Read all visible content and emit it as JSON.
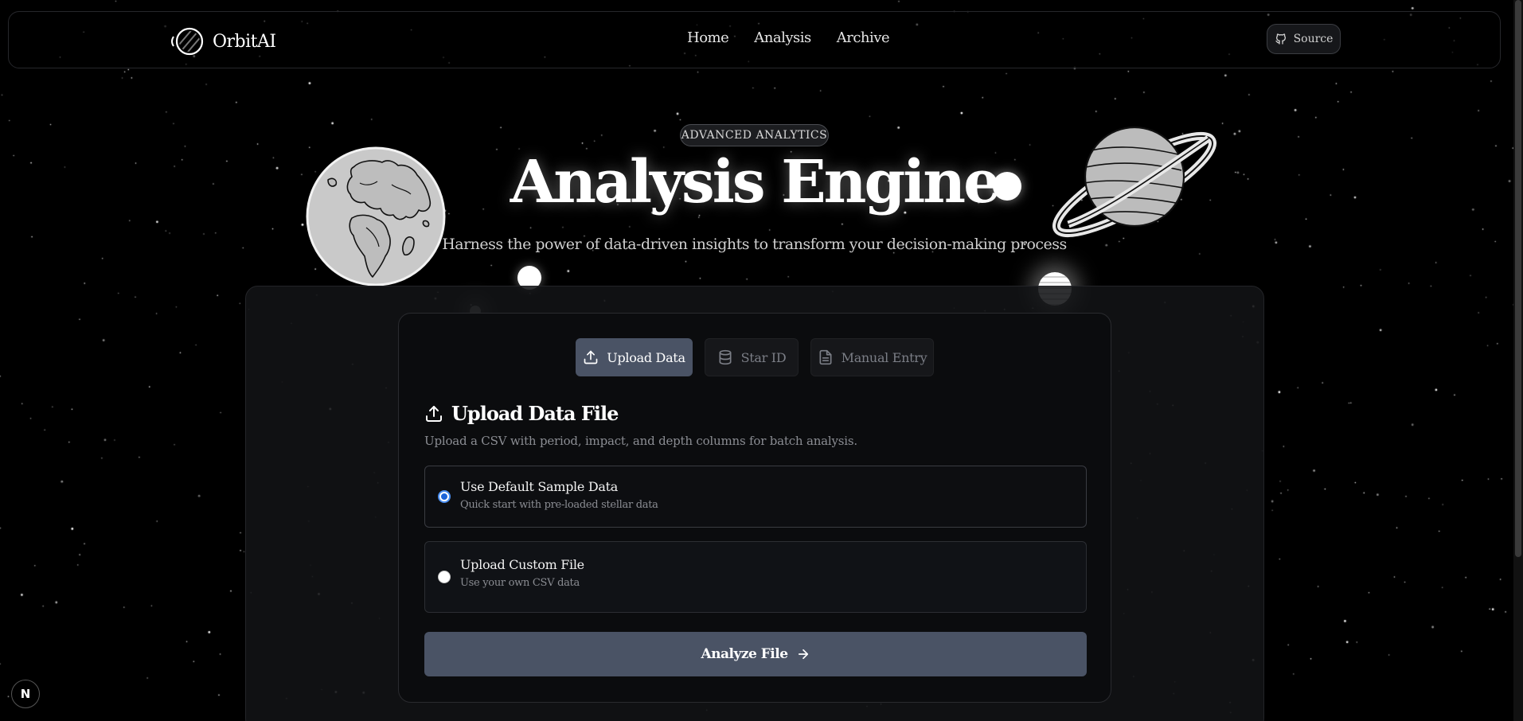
{
  "app": {
    "name": "OrbitAI"
  },
  "nav": {
    "links": [
      "Home",
      "Analysis",
      "Archive"
    ],
    "source_label": "Source"
  },
  "hero": {
    "badge": "ADVANCED ANALYTICS",
    "title": "Analysis Engine",
    "subtitle": "Harness the power of data-driven insights to transform your decision-making process"
  },
  "tabs": [
    {
      "label": "Upload Data",
      "icon": "upload-icon",
      "active": true
    },
    {
      "label": "Star ID",
      "icon": "database-icon",
      "active": false
    },
    {
      "label": "Manual Entry",
      "icon": "document-icon",
      "active": false
    }
  ],
  "upload": {
    "title": "Upload Data File",
    "description": "Upload a CSV with period, impact, and depth columns for batch analysis.",
    "options": [
      {
        "title": "Use Default Sample Data",
        "subtitle": "Quick start with pre-loaded stellar data",
        "selected": true
      },
      {
        "title": "Upload Custom File",
        "subtitle": "Use your own CSV data",
        "selected": false
      }
    ],
    "submit_label": "Analyze File"
  },
  "dev_badge": {
    "letter": "N"
  },
  "colors": {
    "background": "#000000",
    "accent": "#4a5365",
    "radio_selected": "#1c64d8",
    "muted_text": "#8b8d93"
  }
}
